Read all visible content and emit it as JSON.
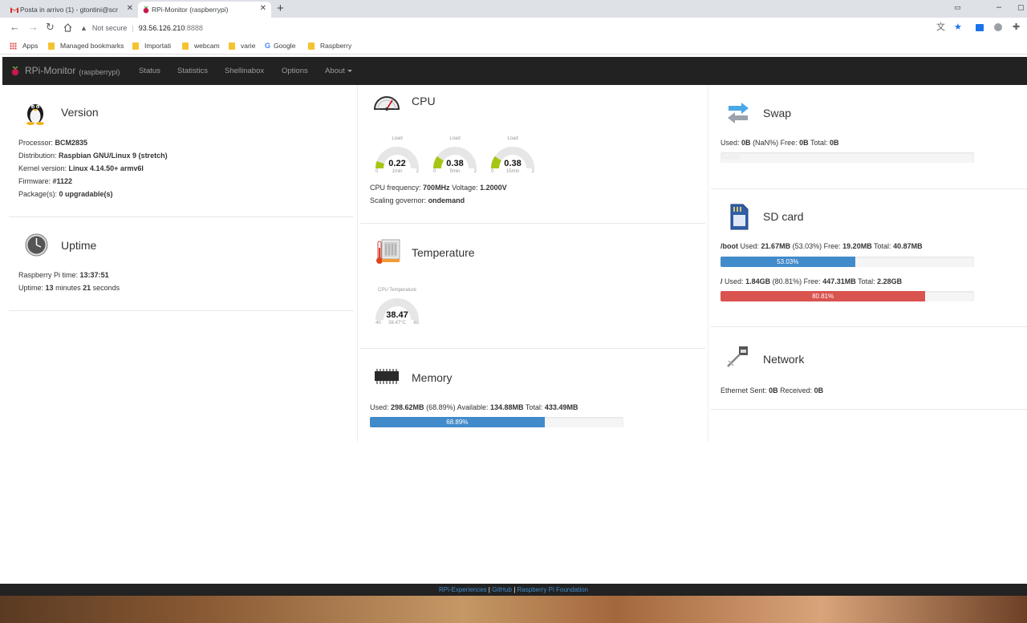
{
  "browser": {
    "tabs": [
      {
        "title": "Posta in arrivo (1) - gtontini@scr",
        "active": false
      },
      {
        "title": "RPi-Monitor (raspberrypi)",
        "active": true
      }
    ],
    "not_secure": "Not secure",
    "url_host": "93.56.126.210",
    "url_port": ":8888",
    "bookmarks": [
      "Apps",
      "Managed bookmarks",
      "Importati",
      "webcam",
      "varie",
      "Google",
      "Raspberry"
    ]
  },
  "navbar": {
    "brand": "RPi-Monitor",
    "hostname": "(raspberrypi)",
    "links": [
      "Status",
      "Statistics",
      "Shellinabox",
      "Options",
      "About"
    ]
  },
  "version": {
    "title": "Version",
    "processor_label": "Processor:",
    "processor": "BCM2835",
    "distribution_label": "Distribution:",
    "distribution": "Raspbian GNU/Linux 9 (stretch)",
    "kernel_label": "Kernel version:",
    "kernel": "Linux 4.14.50+ armv6l",
    "firmware_label": "Firmware:",
    "firmware": "#1122",
    "packages_label": "Package(s):",
    "packages": "0 upgradable(s)"
  },
  "uptime": {
    "title": "Uptime",
    "time_label": "Raspberry Pi time:",
    "time": "13:37:51",
    "uptime_label": "Uptime:",
    "minutes": "13",
    "minutes_word": "minutes",
    "seconds": "21",
    "seconds_word": "seconds"
  },
  "cpu": {
    "title": "CPU",
    "gauges": [
      {
        "title": "Load",
        "value": "0.22",
        "min": "0",
        "max": "2",
        "sub": "1min",
        "level": 0.11
      },
      {
        "title": "Load",
        "value": "0.38",
        "min": "0",
        "max": "2",
        "sub": "5min",
        "level": 0.19
      },
      {
        "title": "Load",
        "value": "0.38",
        "min": "0",
        "max": "2",
        "sub": "15min",
        "level": 0.19
      }
    ],
    "freq_label": "CPU frequency:",
    "freq": "700MHz",
    "voltage_label": "Voltage:",
    "voltage": "1.2000V",
    "governor_label": "Scaling governor:",
    "governor": "ondemand"
  },
  "temperature": {
    "title": "Temperature",
    "gauge": {
      "title": "CPU Temperature",
      "value": "38.47",
      "min": "40",
      "max": "80",
      "sub": "38.47°C",
      "level": 0
    }
  },
  "memory": {
    "title": "Memory",
    "used_label": "Used:",
    "used": "298.62MB",
    "used_pct": "(68.89%)",
    "avail_label": "Available:",
    "available": "134.88MB",
    "total_label": "Total:",
    "total": "433.49MB",
    "bar_label": "68.89%",
    "bar_value": 68.89
  },
  "swap": {
    "title": "Swap",
    "used_label": "Used:",
    "used": "0B",
    "used_pct": "(NaN%)",
    "free_label": "Free:",
    "free": "0B",
    "total_label": "Total:",
    "total": "0B",
    "bar_label": "NaN%"
  },
  "sdcard": {
    "title": "SD card",
    "boot": {
      "mount": "/boot",
      "used_label": "Used:",
      "used": "21.67MB",
      "pct": "(53.03%)",
      "free_label": "Free:",
      "free": "19.20MB",
      "total_label": "Total:",
      "total": "40.87MB",
      "bar_label": "53.03%",
      "bar_value": 53.03
    },
    "root": {
      "mount": "/",
      "used_label": "Used:",
      "used": "1.84GB",
      "pct": "(80.81%)",
      "free_label": "Free:",
      "free": "447.31MB",
      "total_label": "Total:",
      "total": "2.28GB",
      "bar_label": "80.81%",
      "bar_value": 80.81
    }
  },
  "network": {
    "title": "Network",
    "sent_label": "Ethernet Sent:",
    "sent": "0B",
    "recv_label": "Received:",
    "received": "0B"
  },
  "footer": {
    "link1": "RPi-Experiences",
    "sep1": " | ",
    "link2": "GitHub",
    "sep2": " | ",
    "link3": "Raspberry Pi Foundation"
  },
  "colors": {
    "navbar": "#222222",
    "bar_blue": "#428bca",
    "bar_red": "#d9534f",
    "gauge_fill": "#a6c614"
  }
}
